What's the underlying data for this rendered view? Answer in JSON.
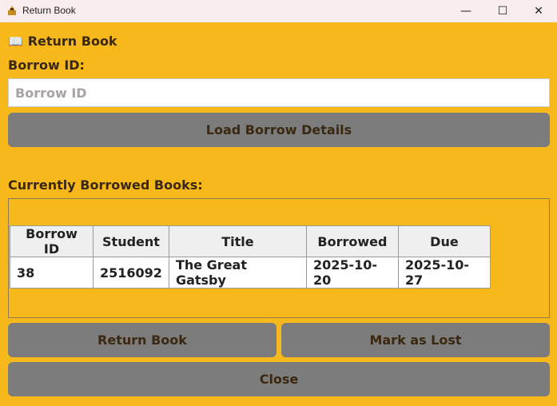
{
  "window": {
    "title": "Return Book",
    "minimize_glyph": "—",
    "maximize_glyph": "☐",
    "close_glyph": "✕"
  },
  "header": {
    "icon": "open-book-icon",
    "icon_glyph": "📖",
    "title": "Return Book"
  },
  "form": {
    "borrow_id_label": "Borrow ID:",
    "borrow_id_placeholder": "Borrow ID",
    "borrow_id_value": "",
    "load_button": "Load Borrow Details"
  },
  "current": {
    "label": "Currently Borrowed Books:",
    "columns": [
      "Borrow ID",
      "Student",
      "Title",
      "Borrowed",
      "Due"
    ],
    "rows": [
      [
        "38",
        "2516092",
        "The Great Gatsby",
        "2025-10-20",
        "2025-10-27"
      ]
    ]
  },
  "actions": {
    "return_button": "Return Book",
    "lost_button": "Mark as Lost",
    "close_button": "Close"
  },
  "colors": {
    "background": "#f6b81a",
    "button": "#7c7c7c",
    "text": "#3a2810"
  }
}
